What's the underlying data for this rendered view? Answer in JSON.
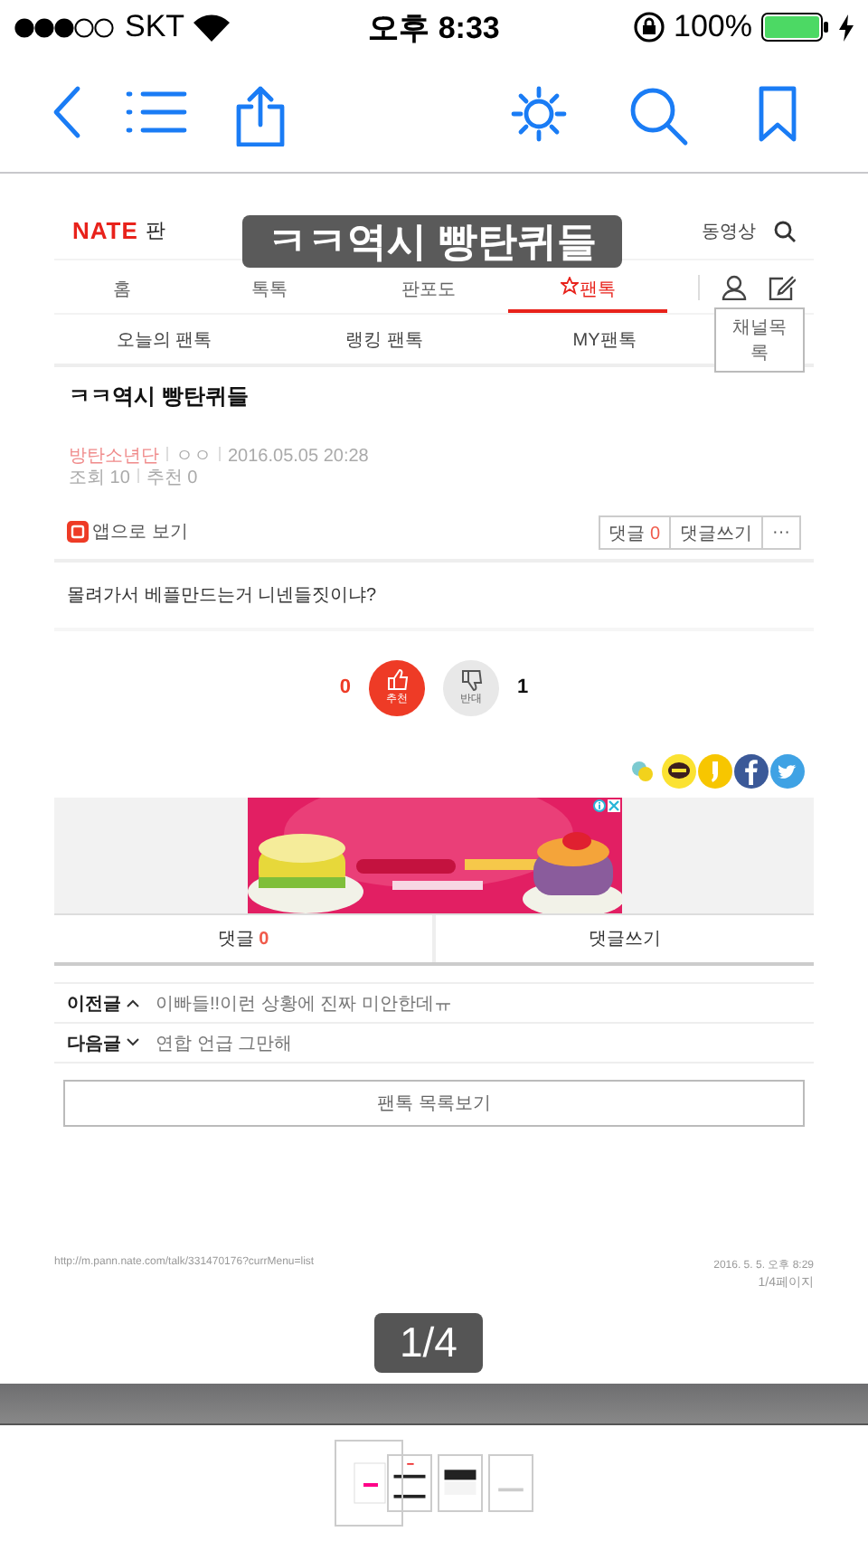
{
  "status_bar": {
    "carrier": "SKT",
    "time": "오후 8:33",
    "battery": "100%"
  },
  "document_title": "ㅋㅋ역시 빵탄퀴들",
  "page": {
    "header": {
      "logo": "NATE",
      "logo_suffix": "판",
      "video_link": "동영상"
    },
    "nav_tabs": [
      {
        "label": "홈",
        "selected": false
      },
      {
        "label": "톡톡",
        "selected": false
      },
      {
        "label": "판포도",
        "selected": false
      },
      {
        "label": "팬톡",
        "selected": true
      }
    ],
    "sub_tabs": [
      "오늘의 팬톡",
      "랭킹 팬톡",
      "MY팬톡"
    ],
    "channel_button": "채널목록",
    "post": {
      "title": "ㅋㅋ역시 빵탄퀴들",
      "author": "방탄소년단",
      "nickname": "ㅇㅇ",
      "date": "2016.05.05 20:28",
      "views": "조회 10",
      "recommends": "추천 0",
      "app_link": "앱으로 보기",
      "comment_label": "댓글",
      "comment_count": "0",
      "write_comment": "댓글쓰기",
      "more": "···",
      "body": "몰려가서 베플만드는거 니넨들짓이냐?"
    },
    "votes": {
      "up_count": "0",
      "up_label": "추천",
      "down_label": "반대",
      "down_count": "1"
    },
    "comment_bar": {
      "label": "댓글",
      "count": "0",
      "write": "댓글쓰기"
    },
    "adjacent": [
      {
        "label": "이전글",
        "kind": "previous",
        "title": "이빠들!!이런 상황에 진짜 미안한데ㅠ"
      },
      {
        "label": "다음글",
        "kind": "next",
        "title": "연합 언급 그만해"
      }
    ],
    "list_button": "팬톡 목록보기",
    "footer": {
      "url": "http://m.pann.nate.com/talk/331470176?currMenu=list",
      "printed": "2016. 5. 5. 오후 8:29",
      "page_of": "1/4페이지"
    }
  },
  "page_indicator": "1/4",
  "thumbnails": [
    {
      "selected": true
    },
    {
      "selected": false
    },
    {
      "selected": false
    },
    {
      "selected": false
    }
  ]
}
